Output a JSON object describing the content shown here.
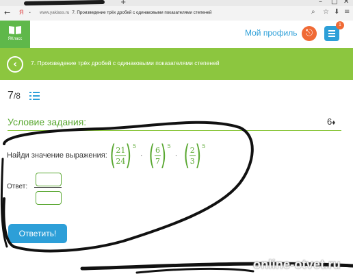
{
  "browser": {
    "url_domain": "www.yaklass.ru",
    "page_title": "7. Произведение трёх дробей с одинаковыми показателями степеней",
    "new_tab": "+"
  },
  "header": {
    "logo_text": "ЯКласс",
    "profile_link": "Мой профиль",
    "notification_count": "1"
  },
  "title_bar": {
    "title": "7. Произведение трёх дробей с одинаковыми показателями степеней"
  },
  "progress": {
    "current": "7",
    "total": "/8"
  },
  "condition": {
    "title": "Условие задания:",
    "points": "6",
    "points_icon": "♦"
  },
  "task": {
    "prompt": "Найди значение выражения:",
    "fractions": [
      {
        "num": "21",
        "den": "24",
        "exp": "5"
      },
      {
        "num": "6",
        "den": "7",
        "exp": "5"
      },
      {
        "num": "2",
        "den": "3",
        "exp": "5"
      }
    ],
    "operator": "·"
  },
  "answer": {
    "label": "Ответ:"
  },
  "submit": {
    "label": "Ответить!"
  },
  "watermark": "online-otvet.ru",
  "colors": {
    "green": "#8cc63f",
    "blue": "#2d9fd8",
    "orange": "#f06a35",
    "math_green": "#5aa832"
  }
}
